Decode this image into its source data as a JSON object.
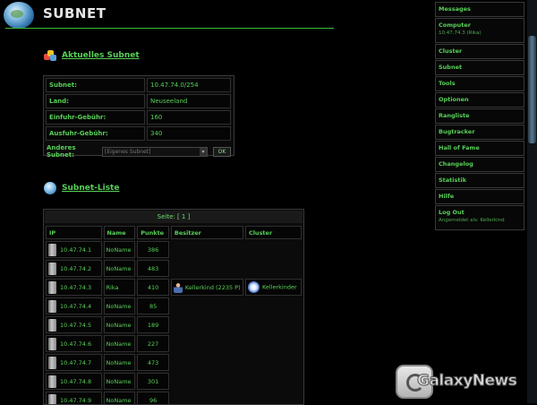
{
  "header": {
    "title": "SUBNET"
  },
  "current": {
    "heading": "Aktuelles Subnet",
    "rows": [
      {
        "label": "Subnet:",
        "value": "10.47.74.0/254"
      },
      {
        "label": "Land:",
        "value": "Neuseeland"
      },
      {
        "label": "Einfuhr-Gebühr:",
        "value": "160"
      },
      {
        "label": "Ausfuhr-Gebühr:",
        "value": "340"
      }
    ],
    "other_label": "Anderes Subnet:",
    "select_value": "[Eigenes Subnet]",
    "ok_label": "OK"
  },
  "list": {
    "heading": "Subnet-Liste",
    "pages": "Seite: [ 1 ]",
    "columns": [
      "IP",
      "Name",
      "Punkte",
      "Besitzer",
      "Cluster"
    ],
    "rows": [
      {
        "ip": "10.47.74.1",
        "name": "NoName",
        "points": "386",
        "owner": "",
        "cluster": ""
      },
      {
        "ip": "10.47.74.2",
        "name": "NoName",
        "points": "483",
        "owner": "",
        "cluster": ""
      },
      {
        "ip": "10.47.74.3",
        "name": "Rika",
        "points": "410",
        "owner": "Kellerkind (2235 P)",
        "cluster": "Kellerkinder"
      },
      {
        "ip": "10.47.74.4",
        "name": "NoName",
        "points": "85",
        "owner": "",
        "cluster": ""
      },
      {
        "ip": "10.47.74.5",
        "name": "NoName",
        "points": "189",
        "owner": "",
        "cluster": ""
      },
      {
        "ip": "10.47.74.6",
        "name": "NoName",
        "points": "227",
        "owner": "",
        "cluster": ""
      },
      {
        "ip": "10.47.74.7",
        "name": "NoName",
        "points": "473",
        "owner": "",
        "cluster": ""
      },
      {
        "ip": "10.47.74.8",
        "name": "NoName",
        "points": "301",
        "owner": "",
        "cluster": ""
      },
      {
        "ip": "10.47.74.9",
        "name": "NoName",
        "points": "96",
        "owner": "",
        "cluster": ""
      }
    ]
  },
  "sidebar": {
    "items": [
      {
        "label": "Messages",
        "sub": ""
      },
      {
        "label": "Computer",
        "sub": "10.47.74.3 (Rika)"
      },
      {
        "label": "Cluster",
        "sub": ""
      },
      {
        "label": "Subnet",
        "sub": ""
      },
      {
        "label": "Tools",
        "sub": ""
      },
      {
        "label": "Optionen",
        "sub": ""
      },
      {
        "label": "Rangliste",
        "sub": ""
      },
      {
        "label": "Bugtracker",
        "sub": ""
      },
      {
        "label": "Hall of Fame",
        "sub": ""
      },
      {
        "label": "Changelog",
        "sub": ""
      },
      {
        "label": "Statistik",
        "sub": ""
      },
      {
        "label": "Hilfe",
        "sub": ""
      },
      {
        "label": "Log Out",
        "sub": "Angemeldet als: Kellerkind"
      }
    ]
  },
  "watermark": {
    "text": "GalaxyNews"
  },
  "icons": {
    "header": "globe-icon",
    "current": "subnet-icon",
    "list": "globe-icon",
    "server": "server-icon",
    "owner": "user-icon",
    "cluster": "cluster-icon"
  },
  "colors": {
    "accent": "#58d058",
    "rule": "#3bbf3b",
    "background": "#000000"
  }
}
